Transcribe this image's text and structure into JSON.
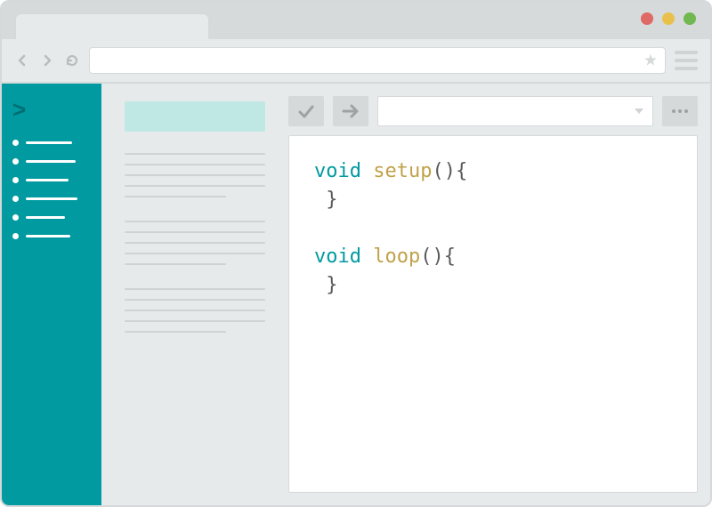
{
  "colors": {
    "teal": "#009aa0",
    "light_close": "#df6965",
    "light_min": "#e9c14a",
    "light_max": "#70b84f"
  },
  "sidebar": {
    "prompt": ">",
    "item_widths": [
      52,
      56,
      48,
      58,
      44,
      50
    ]
  },
  "code": {
    "kw": "void",
    "fn1": "setup",
    "fn2": "loop",
    "paren_open": "(){",
    "brace_close": "}"
  }
}
